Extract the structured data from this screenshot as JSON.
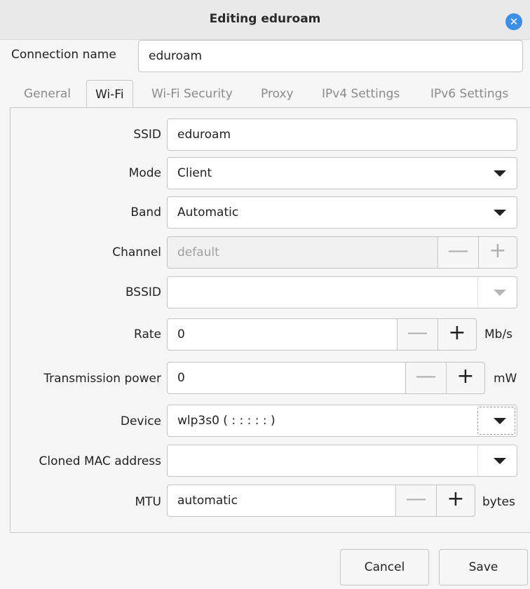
{
  "window": {
    "title": "Editing eduroam",
    "close_icon": "close-icon"
  },
  "connection": {
    "label": "Connection name",
    "value": "eduroam"
  },
  "tabs": [
    {
      "label": "General"
    },
    {
      "label": "Wi-Fi"
    },
    {
      "label": "Wi-Fi Security"
    },
    {
      "label": "Proxy"
    },
    {
      "label": "IPv4 Settings"
    },
    {
      "label": "IPv6 Settings"
    }
  ],
  "active_tab": "Wi-Fi",
  "wifi": {
    "ssid": {
      "label": "SSID",
      "value": "eduroam"
    },
    "mode": {
      "label": "Mode",
      "value": "Client"
    },
    "band": {
      "label": "Band",
      "value": "Automatic"
    },
    "channel": {
      "label": "Channel",
      "value": "default"
    },
    "bssid": {
      "label": "BSSID",
      "value": ""
    },
    "rate": {
      "label": "Rate",
      "value": "0",
      "unit": "Mb/s"
    },
    "tx_power": {
      "label": "Transmission power",
      "value": "0",
      "unit": "mW"
    },
    "device": {
      "label": "Device",
      "value": "wlp3s0 (  :  :  :  :  :  )"
    },
    "cloned_mac": {
      "label": "Cloned MAC address",
      "value": ""
    },
    "mtu": {
      "label": "MTU",
      "value": "automatic",
      "unit": "bytes"
    }
  },
  "spin": {
    "minus": "—",
    "plus": "+"
  },
  "buttons": {
    "cancel": "Cancel",
    "save": "Save"
  },
  "colors": {
    "accent": "#3d8ee5"
  }
}
